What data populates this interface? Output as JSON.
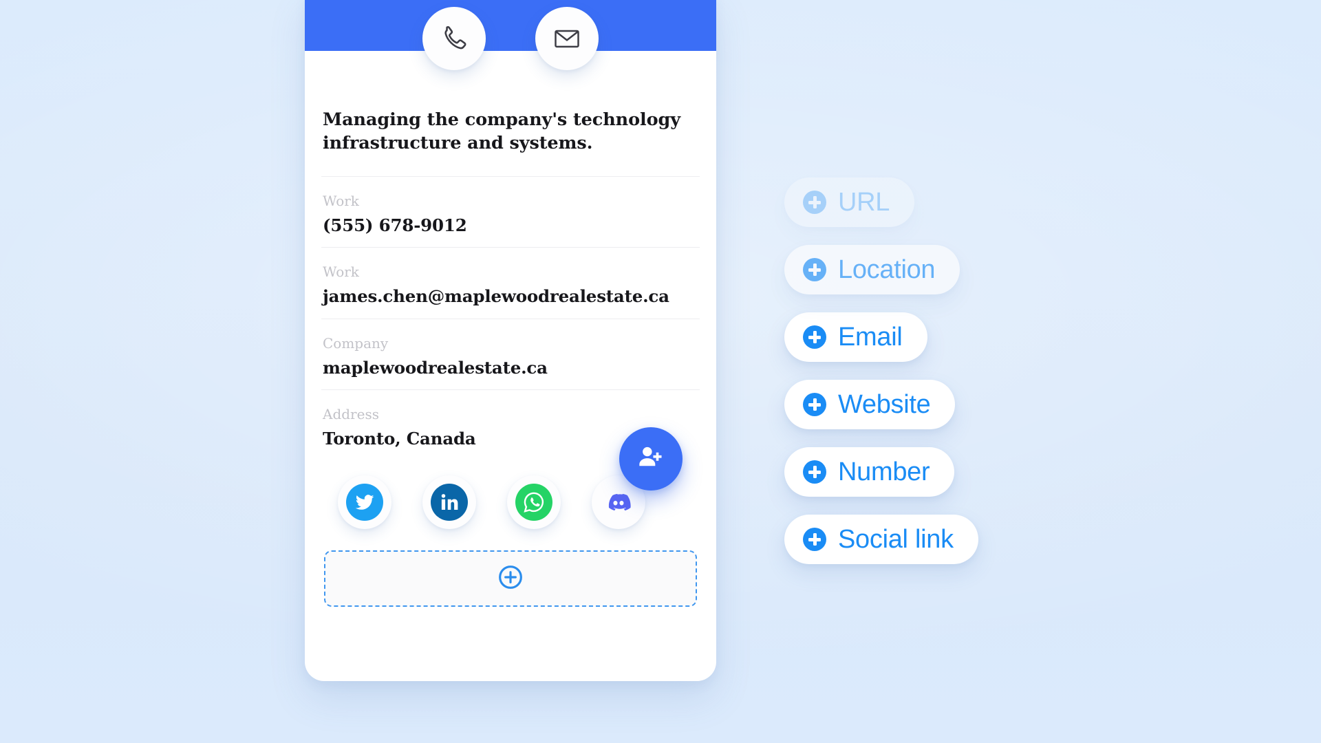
{
  "theme": {
    "page_background": "#dbeafc",
    "brand_blue": "#3b6ef6",
    "accent_blue": "#1a8cf5",
    "card_white": "#ffffff",
    "label_gray": "#c2c2c8",
    "value_black": "#17171b",
    "divider_gray": "#ededf0"
  },
  "card": {
    "header": {
      "background": "#3b6ef6",
      "actions": [
        {
          "name": "phone-icon",
          "label": "Call"
        },
        {
          "name": "envelope-icon",
          "label": "Email"
        }
      ]
    },
    "bio": "Managing the company's technology infrastructure and systems.",
    "fields": [
      {
        "label": "Work",
        "value": "(555) 678-9012"
      },
      {
        "label": "Work",
        "value": "james.chen@maplewoodrealestate.ca"
      },
      {
        "label": "Company",
        "value": "maplewoodrealestate.ca"
      },
      {
        "label": "Address",
        "value": "Toronto, Canada"
      }
    ],
    "social_links": [
      {
        "name": "twitter",
        "label": "Twitter",
        "color": "#1da1f2"
      },
      {
        "name": "linkedin",
        "label": "LinkedIn",
        "color": "#0a66a8"
      },
      {
        "name": "whatsapp",
        "label": "WhatsApp",
        "color": "#25d366"
      },
      {
        "name": "discord",
        "label": "Discord",
        "color": "#5865f2"
      }
    ],
    "add_field_button": {
      "icon": "plus-circle-icon",
      "label": ""
    },
    "add_contact_fab": {
      "icon": "person-add-icon",
      "label": "",
      "color": "#3b6ef6"
    }
  },
  "pill_menu": {
    "items": [
      {
        "label": "URL",
        "opacity_state": "fading-in"
      },
      {
        "label": "Location",
        "opacity_state": "fading-in"
      },
      {
        "label": "Email",
        "opacity_state": "visible"
      },
      {
        "label": "Website",
        "opacity_state": "visible"
      },
      {
        "label": "Number",
        "opacity_state": "visible"
      },
      {
        "label": "Social link",
        "opacity_state": "visible"
      }
    ]
  }
}
